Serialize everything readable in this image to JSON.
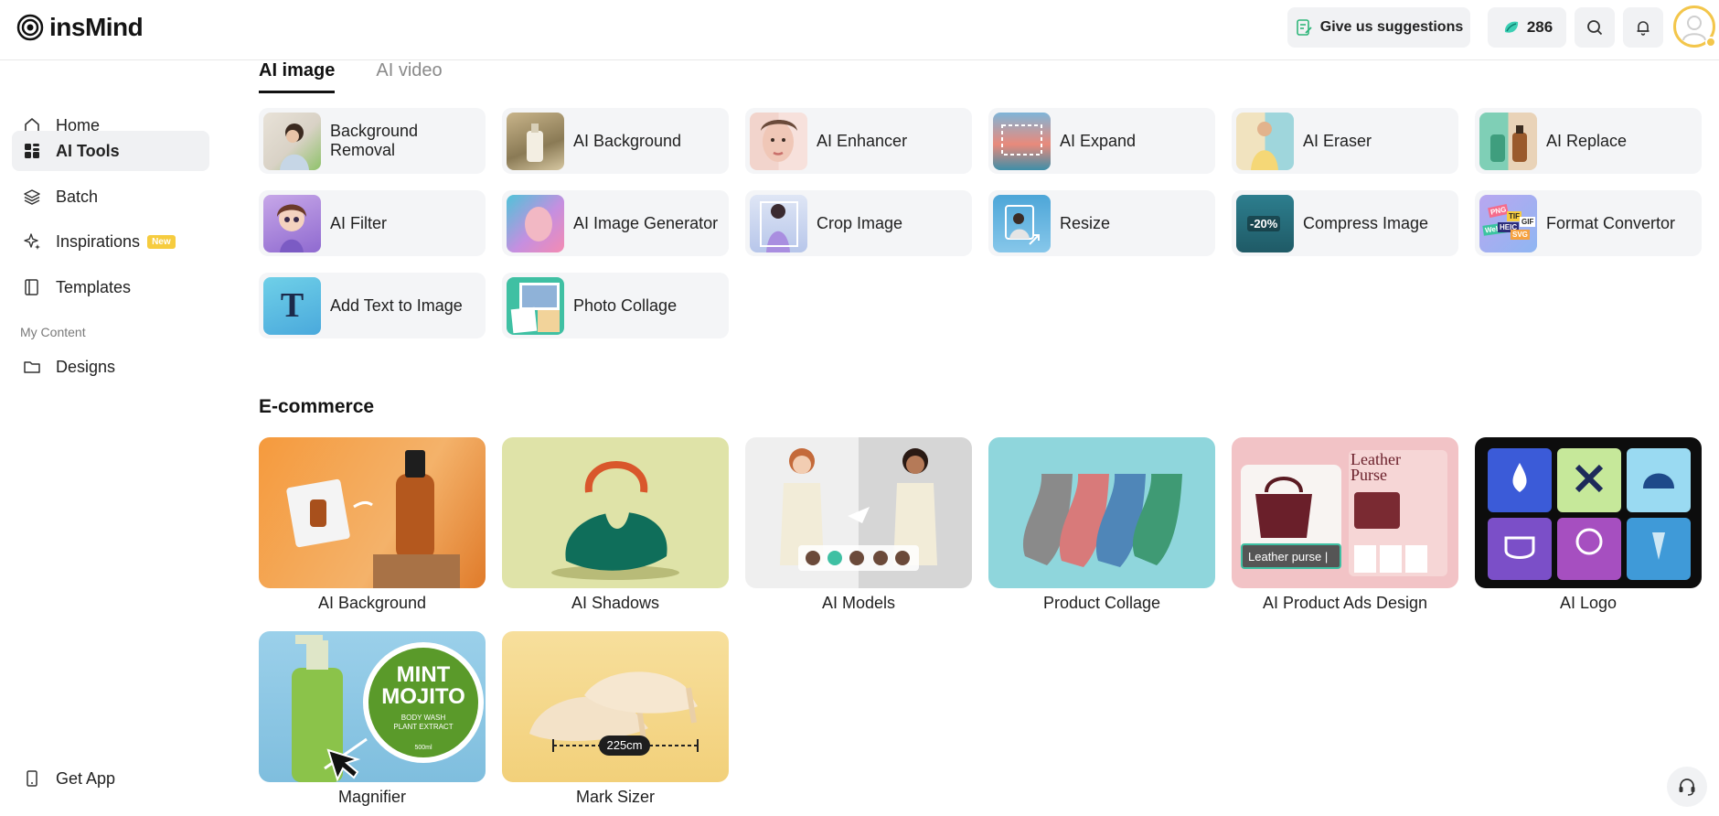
{
  "app": {
    "name": "insMind"
  },
  "header": {
    "suggestions_label": "Give us suggestions",
    "credits": "286"
  },
  "sidebar": {
    "items": [
      {
        "label": "Home",
        "icon": "home-icon"
      },
      {
        "label": "AI Tools",
        "icon": "grid-icon",
        "active": true
      },
      {
        "label": "Batch",
        "icon": "layers-icon"
      },
      {
        "label": "Inspirations",
        "icon": "sparkle-icon",
        "badge": "New"
      },
      {
        "label": "Templates",
        "icon": "book-icon"
      }
    ],
    "section_label": "My Content",
    "content_items": [
      {
        "label": "Designs",
        "icon": "folder-icon"
      }
    ],
    "get_app_label": "Get App"
  },
  "tabs": [
    {
      "label": "AI image",
      "active": true
    },
    {
      "label": "AI video"
    }
  ],
  "ai_image_tools": [
    "Background Removal",
    "AI Background",
    "AI Enhancer",
    "AI Expand",
    "AI Eraser",
    "AI Replace",
    "AI Filter",
    "AI Image Generator",
    "Crop Image",
    "Resize",
    "Compress Image",
    "Format Convertor",
    "Add Text to Image",
    "Photo Collage"
  ],
  "ecommerce": {
    "title": "E-commerce",
    "cards": [
      "AI Background",
      "AI Shadows",
      "AI Models",
      "Product Collage",
      "AI Product Ads Design",
      "AI Logo",
      "Magnifier",
      "Mark Sizer"
    ],
    "ads_overlay": {
      "heading": "Leather Purse",
      "input_text": "Leather purse |"
    },
    "magnifier_overlay": {
      "line1": "MINT",
      "line2": "MOJITO",
      "line3": "BODY WASH",
      "line4": "PLANT EXTRACT",
      "line5": "500ml"
    },
    "sizer_overlay": "225cm",
    "compress_overlay": "-20%",
    "format_overlay": [
      "PNG",
      "TIF",
      "GIF",
      "Webp",
      "HEIC",
      "SVG"
    ],
    "text_tool_letter": "T"
  },
  "colors": {
    "accent_yellow": "#f6cc3f",
    "active_bg": "#f0f1f3",
    "tool_bg": "#f4f5f7"
  }
}
